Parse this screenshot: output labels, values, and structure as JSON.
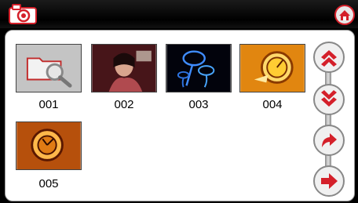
{
  "header": {
    "camera_icon": "camera-icon",
    "home_icon": "home-icon"
  },
  "gallery": {
    "items": [
      {
        "label": "001",
        "icon": "folder-search-icon"
      },
      {
        "label": "002",
        "icon": "photo-thumbnail"
      },
      {
        "label": "003",
        "icon": "photo-thumbnail"
      },
      {
        "label": "004",
        "icon": "photo-thumbnail"
      },
      {
        "label": "005",
        "icon": "photo-thumbnail"
      }
    ]
  },
  "nav": {
    "buttons": [
      {
        "name": "page-up-button",
        "icon": "double-chevron-up-icon"
      },
      {
        "name": "page-down-button",
        "icon": "double-chevron-down-icon"
      },
      {
        "name": "back-button",
        "icon": "return-arrow-icon"
      },
      {
        "name": "next-button",
        "icon": "right-arrow-icon"
      }
    ]
  },
  "colors": {
    "accent": "#d4202a",
    "bar": "#000000"
  }
}
